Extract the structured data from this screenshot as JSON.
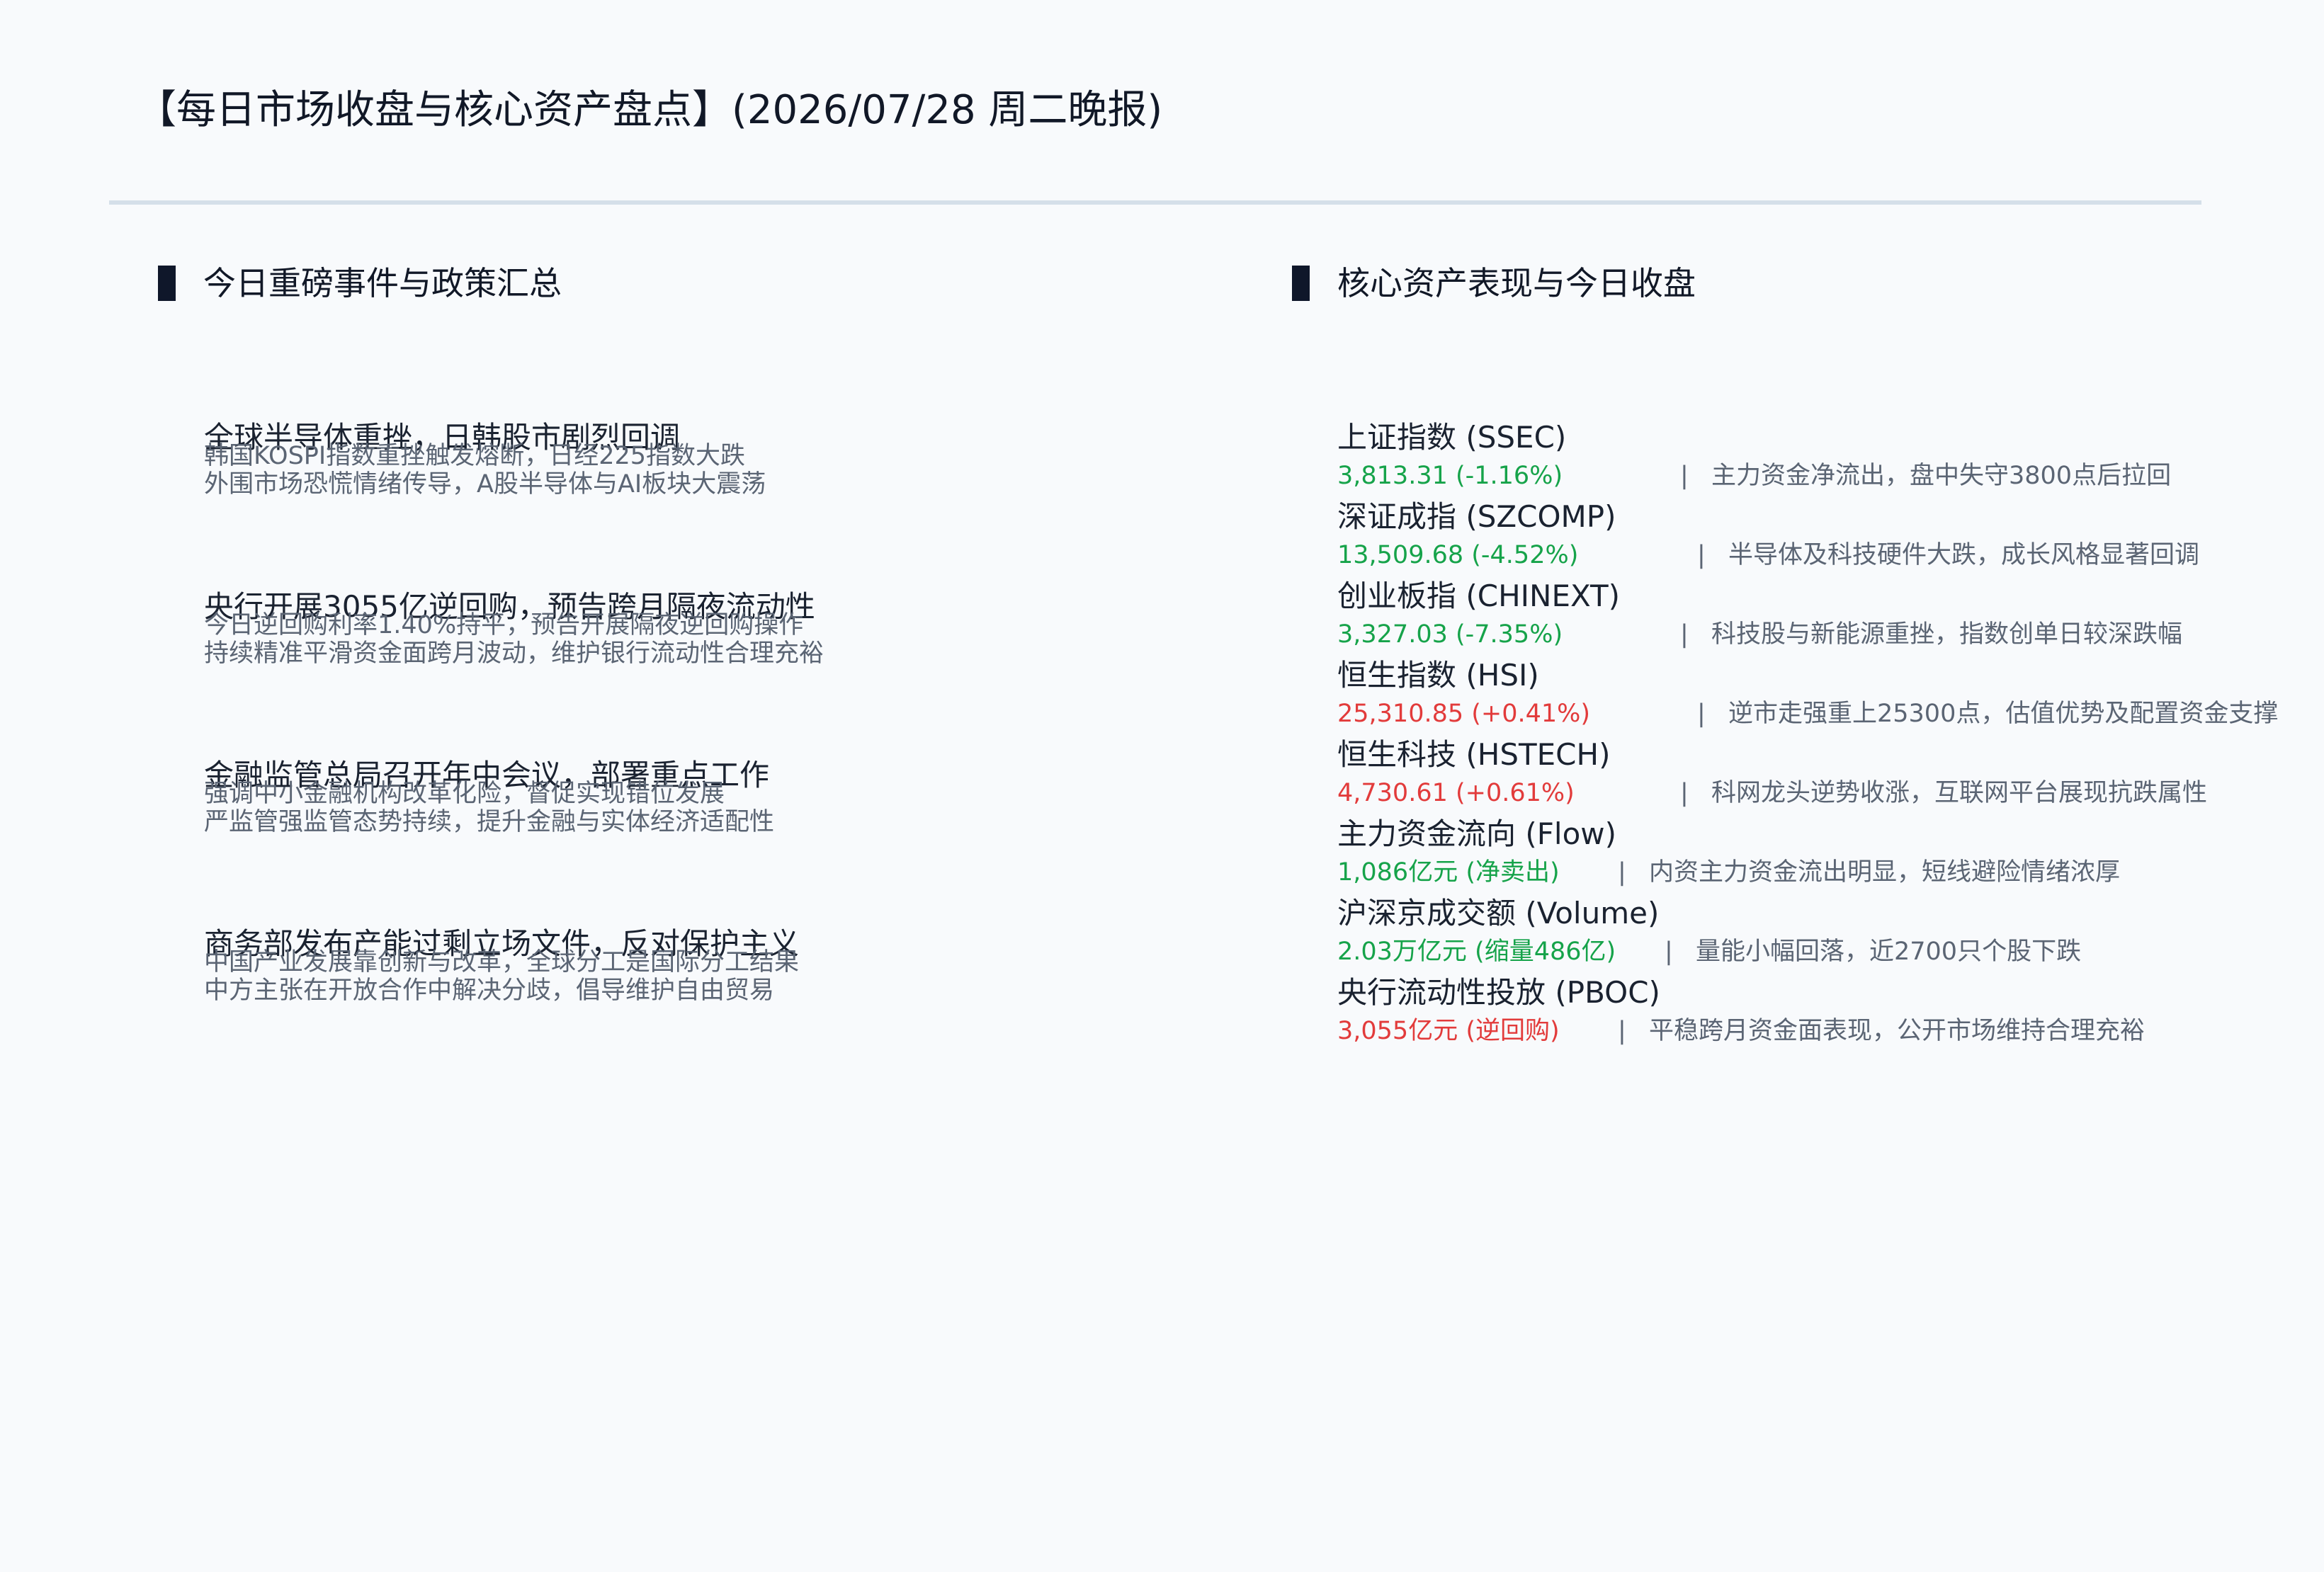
{
  "header": {
    "title": "【每日市场收盘与核心资产盘点】(2026/07/28 周二晚报)"
  },
  "left_section": {
    "heading": "今日重磅事件与政策汇总",
    "events": [
      {
        "title": "全球半导体重挫，日韩股市剧烈回调",
        "line1": "韩国KOSPI指数重挫触发熔断，日经225指数大跌",
        "line2": "外围市场恐慌情绪传导，A股半导体与AI板块大震荡"
      },
      {
        "title": "央行开展3055亿逆回购，预告跨月隔夜流动性",
        "line1": "今日逆回购利率1.40%持平，预告开展隔夜逆回购操作",
        "line2": "持续精准平滑资金面跨月波动，维护银行流动性合理充裕"
      },
      {
        "title": "金融监管总局召开年中会议，部署重点工作",
        "line1": "强调中小金融机构改革化险，督促实现错位发展",
        "line2": "严监管强监管态势持续，提升金融与实体经济适配性"
      },
      {
        "title": "商务部发布产能过剩立场文件，反对保护主义",
        "line1": "中国产业发展靠创新与改革，全球分工是国际分工结果",
        "line2": "中方主张在开放合作中解决分歧，倡导维护自由贸易"
      }
    ]
  },
  "right_section": {
    "heading": "核心资产表现与今日收盘",
    "separator": "|",
    "assets": [
      {
        "name": "上证指数 (SSEC)",
        "value": "3,813.31 (-1.16%)",
        "direction": "down",
        "comment": "主力资金净流出，盘中失守3800点后拉回"
      },
      {
        "name": "深证成指 (SZCOMP)",
        "value": "13,509.68 (-4.52%)",
        "direction": "down",
        "comment": "半导体及科技硬件大跌，成长风格显著回调"
      },
      {
        "name": "创业板指 (CHINEXT)",
        "value": "3,327.03 (-7.35%)",
        "direction": "down",
        "comment": "科技股与新能源重挫，指数创单日较深跌幅"
      },
      {
        "name": "恒生指数 (HSI)",
        "value": "25,310.85 (+0.41%)",
        "direction": "up",
        "comment": "逆市走强重上25300点，估值优势及配置资金支撑"
      },
      {
        "name": "恒生科技 (HSTECH)",
        "value": "4,730.61 (+0.61%)",
        "direction": "up",
        "comment": "科网龙头逆势收涨，互联网平台展现抗跌属性"
      },
      {
        "name": "主力资金流向 (Flow)",
        "value": "1,086亿元 (净卖出)",
        "direction": "down",
        "comment": "内资主力资金流出明显，短线避险情绪浓厚"
      },
      {
        "name": "沪深京成交额 (Volume)",
        "value": "2.03万亿元 (缩量486亿)",
        "direction": "down",
        "comment": "量能小幅回落，近2700只个股下跌"
      },
      {
        "name": "央行流动性投放 (PBOC)",
        "value": "3,055亿元 (逆回购)",
        "direction": "up",
        "comment": "平稳跨月资金面表现，公开市场维持合理充裕"
      }
    ]
  },
  "colors": {
    "down": "#16a34a",
    "up": "#e23b3b",
    "divider": "#d5dfe9",
    "text_primary": "#1a2230",
    "text_secondary": "#5b6574"
  }
}
